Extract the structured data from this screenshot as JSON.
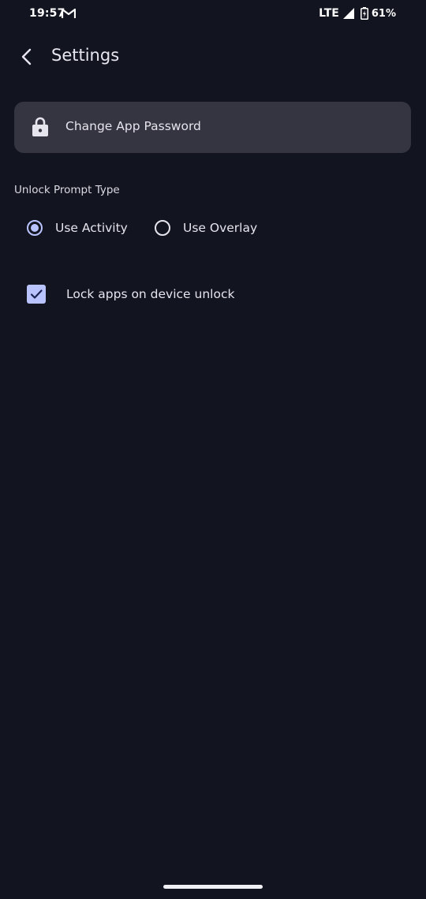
{
  "status_bar": {
    "time": "19:57",
    "network": "LTE",
    "battery": "61%",
    "notification_icon": "gmail-icon"
  },
  "app_bar": {
    "title": "Settings",
    "back_icon": "chevron-left-icon"
  },
  "password_card": {
    "label": "Change App Password",
    "icon": "lock-icon"
  },
  "unlock_prompt": {
    "section_label": "Unlock Prompt Type",
    "options": [
      {
        "label": "Use Activity",
        "selected": true
      },
      {
        "label": "Use Overlay",
        "selected": false
      }
    ]
  },
  "lock_on_unlock": {
    "label": "Lock apps on device unlock",
    "checked": true
  },
  "colors": {
    "background": "#121420",
    "card": "#343541",
    "accent": "#b9c4ff",
    "text": "#e6e4ec"
  }
}
